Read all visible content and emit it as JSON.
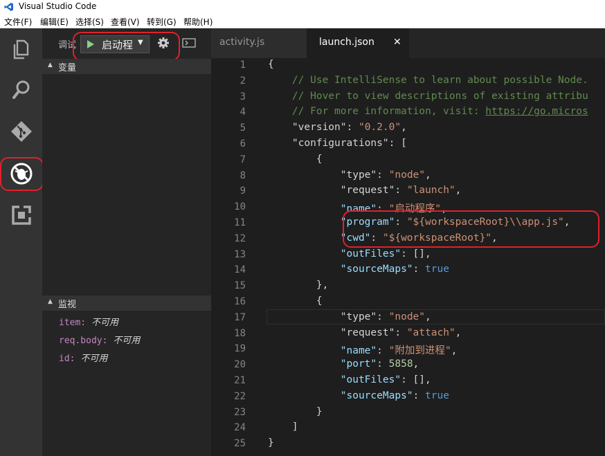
{
  "window": {
    "title": "Visual Studio Code"
  },
  "menu": [
    "文件(F)",
    "编辑(E)",
    "选择(S)",
    "查看(V)",
    "转到(G)",
    "帮助(H)"
  ],
  "debug_toolbar": {
    "label": "调试",
    "config_name": "启动程",
    "dropdown_arrow": "▼"
  },
  "sidebar": {
    "variables_title": "变量",
    "watch_title": "监视",
    "watch_items": [
      {
        "name": "item:",
        "value": "不可用"
      },
      {
        "name": "req.body:",
        "value": "不可用"
      },
      {
        "name": "id:",
        "value": "不可用"
      }
    ]
  },
  "tabs": [
    {
      "label": "activity.js",
      "active": false
    },
    {
      "label": "launch.json",
      "active": true,
      "close": "✕"
    }
  ],
  "editor": {
    "line_numbers": [
      "1",
      "2",
      "3",
      "4",
      "5",
      "6",
      "7",
      "8",
      "9",
      "10",
      "11",
      "12",
      "13",
      "14",
      "15",
      "16",
      "17",
      "18",
      "19",
      "20",
      "21",
      "22",
      "23",
      "24",
      "25"
    ],
    "comments": {
      "c1": "// Use IntelliSense to learn about possible Node.",
      "c2": "// Hover to view descriptions of existing attribu",
      "c3": "// For more information, visit: ",
      "c3_link": "https://go.micros"
    },
    "keys": {
      "version": "\"version\"",
      "configurations": "\"configurations\"",
      "type": "\"type\"",
      "request": "\"request\"",
      "name": "\"name\"",
      "program": "\"program\"",
      "cwd": "\"cwd\"",
      "outFiles": "\"outFiles\"",
      "sourceMaps": "\"sourceMaps\"",
      "port": "\"port\""
    },
    "values": {
      "version": "\"0.2.0\"",
      "node": "\"node\"",
      "launch": "\"launch\"",
      "attach": "\"attach\"",
      "name1": "\"启动程序\"",
      "name2": "\"附加到进程\"",
      "program": "\"${workspaceRoot}\\\\app.js\"",
      "cwd": "\"${workspaceRoot}\"",
      "true": "true",
      "port": "5858"
    }
  },
  "colors": {
    "highlight": "#e0212b",
    "activity_bar": "#333333",
    "editor_bg": "#1e1e1e"
  },
  "icons": [
    "vscode-logo-icon",
    "files-icon",
    "search-icon",
    "git-icon",
    "debug-icon",
    "extensions-icon",
    "play-icon",
    "gear-icon",
    "terminal-icon",
    "close-icon"
  ]
}
